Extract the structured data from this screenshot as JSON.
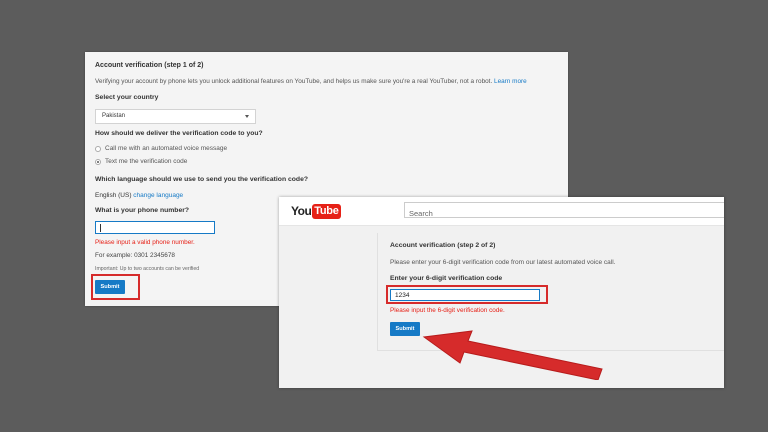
{
  "step1": {
    "title": "Account verification (step 1 of 2)",
    "description": "Verifying your account by phone lets you unlock additional features on YouTube, and helps us make sure you're a real YouTuber, not a robot.",
    "learn_more": "Learn more",
    "country_label": "Select your country",
    "country_value": "Pakistan",
    "delivery_label": "How should we deliver the verification code to you?",
    "delivery_options": [
      {
        "label": "Call me with an automated voice message",
        "selected": false
      },
      {
        "label": "Text me the verification code",
        "selected": true
      }
    ],
    "language_label": "Which language should we use to send you the verification code?",
    "language_value": "English (US)",
    "change_language": "change language",
    "phone_label": "What is your phone number?",
    "phone_value": "",
    "error": "Please input a valid phone number.",
    "example": "For example: 0301 2345678",
    "important": "Important: Up to two accounts can be verified",
    "submit": "Submit"
  },
  "step2": {
    "logo_you": "You",
    "logo_tube": "Tube",
    "search_placeholder": "Search",
    "title": "Account verification (step 2 of 2)",
    "description": "Please enter your 6-digit verification code from our latest automated voice call.",
    "code_label": "Enter your 6-digit verification code",
    "code_value": "1234",
    "error": "Please input the 6-digit verification code.",
    "submit": "Submit"
  },
  "colors": {
    "accent": "#167ac6",
    "error": "#e62117",
    "highlight": "#d62b2b",
    "background": "#5c5c5c"
  }
}
